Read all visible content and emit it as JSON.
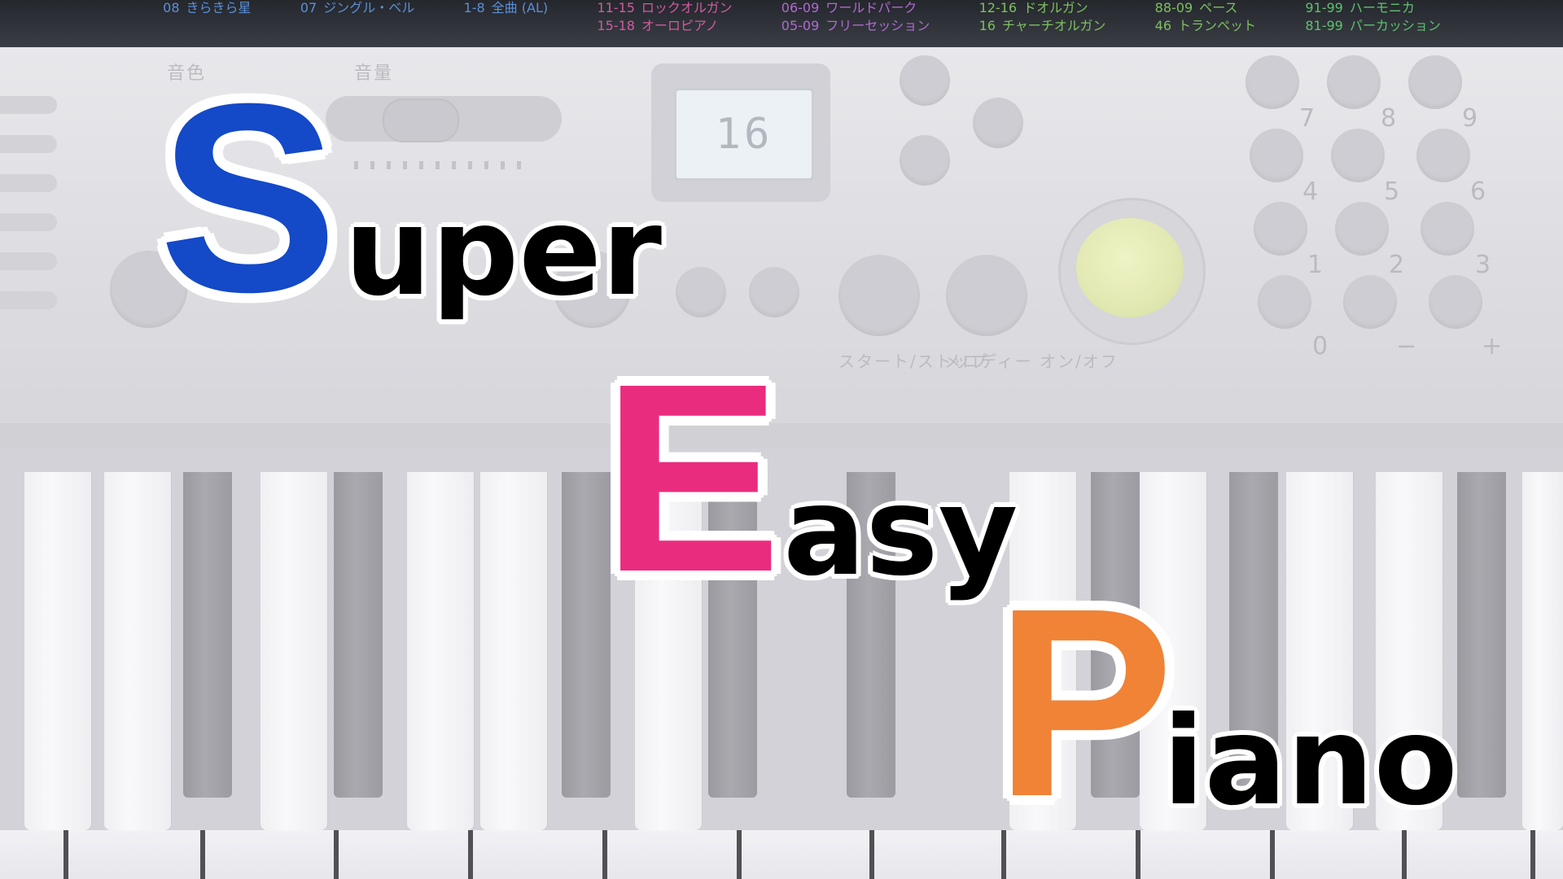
{
  "title": {
    "words": [
      {
        "capital": "S",
        "rest": "uper",
        "capital_color": "#1449c8"
      },
      {
        "capital": "E",
        "rest": "asy",
        "capital_color": "#ea2c7e"
      },
      {
        "capital": "P",
        "rest": "iano",
        "capital_color": "#f08336"
      }
    ],
    "rest_color": "#000000",
    "outline_color": "#ffffff"
  },
  "keyboard_panel": {
    "display_value": "16",
    "tone_list": [
      {
        "num": "08",
        "name": "きらきら星",
        "color": "#5a8fd8"
      },
      {
        "num": "07",
        "name": "ジングル・ベル",
        "color": "#5a8fd8"
      },
      {
        "num": "1-8",
        "name": "全曲 (AL)",
        "color": "#5a8fd8"
      },
      {
        "num": "11-15",
        "name": "ロックオルガン",
        "color": "#d05ba0"
      },
      {
        "num": "15-18",
        "name": "オーロピアノ",
        "color": "#d05ba0"
      },
      {
        "num": "06-09",
        "name": "ワールドパーク",
        "color": "#b06ad0"
      },
      {
        "num": "05-09",
        "name": "フリーセッション",
        "color": "#b06ad0"
      },
      {
        "num": "12-16",
        "name": "ドオルガン",
        "color": "#7fbf60"
      },
      {
        "num": "16",
        "name": "チャーチオルガン",
        "color": "#7fbf60"
      },
      {
        "num": "88-09",
        "name": "ペース",
        "color": "#7fbf60"
      },
      {
        "num": "46",
        "name": "トランペット",
        "color": "#7fbf60"
      },
      {
        "num": "91-99",
        "name": "ハーモニカ",
        "color": "#5fc070"
      },
      {
        "num": "81-99",
        "name": "パーカッション",
        "color": "#5fc070"
      }
    ],
    "panel_labels": [
      "音色",
      "音量"
    ],
    "keypad_digits": [
      "7",
      "8",
      "9",
      "4",
      "5",
      "6",
      "1",
      "2",
      "3",
      "0",
      "−",
      "+"
    ],
    "button_labels": [
      "スタート/ストップ",
      "メロディー オン/オフ"
    ]
  }
}
